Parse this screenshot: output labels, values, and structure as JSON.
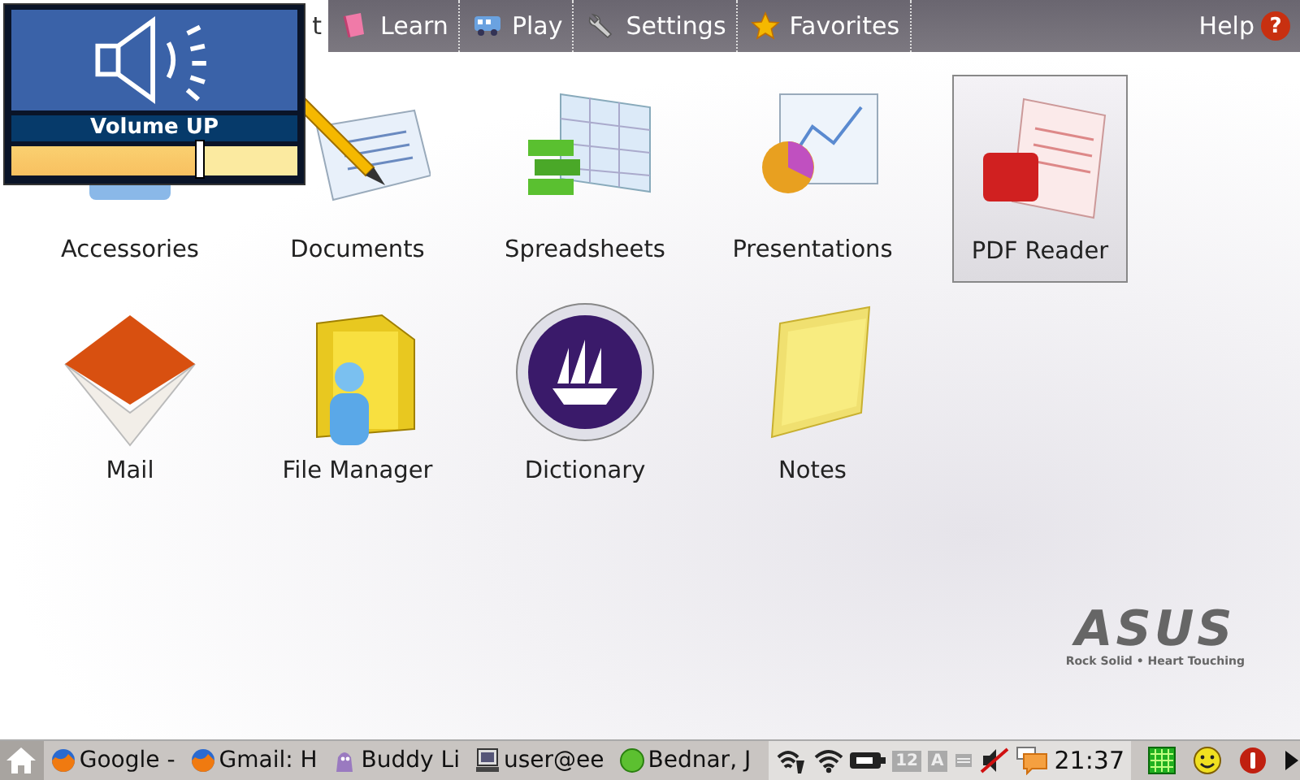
{
  "tabs": [
    {
      "label": "t",
      "selected": true
    },
    {
      "label": "Learn",
      "selected": false
    },
    {
      "label": "Play",
      "selected": false
    },
    {
      "label": "Settings",
      "selected": false
    },
    {
      "label": "Favorites",
      "selected": false
    }
  ],
  "help": {
    "label": "Help",
    "badge": "?"
  },
  "apps": [
    {
      "label": "Accessories",
      "selected": false
    },
    {
      "label": "Documents",
      "selected": false
    },
    {
      "label": "Spreadsheets",
      "selected": false
    },
    {
      "label": "Presentations",
      "selected": false
    },
    {
      "label": "PDF Reader",
      "selected": true
    },
    {
      "label": "Mail",
      "selected": false
    },
    {
      "label": "File Manager",
      "selected": false
    },
    {
      "label": "Dictionary",
      "selected": false
    },
    {
      "label": "Notes",
      "selected": false
    }
  ],
  "volume_osd": {
    "label": "Volume UP",
    "level": 0.66
  },
  "logo": {
    "brand": "ASUS",
    "tagline": "Rock Solid • Heart Touching"
  },
  "taskbar": {
    "tasks": [
      {
        "label": "Google -"
      },
      {
        "label": "Gmail: H"
      },
      {
        "label": "Buddy Li"
      },
      {
        "label": "user@ee"
      },
      {
        "label": "Bednar, J"
      }
    ],
    "input_indicator": "12",
    "keyboard_indicator": "A",
    "clock": "21:37"
  }
}
